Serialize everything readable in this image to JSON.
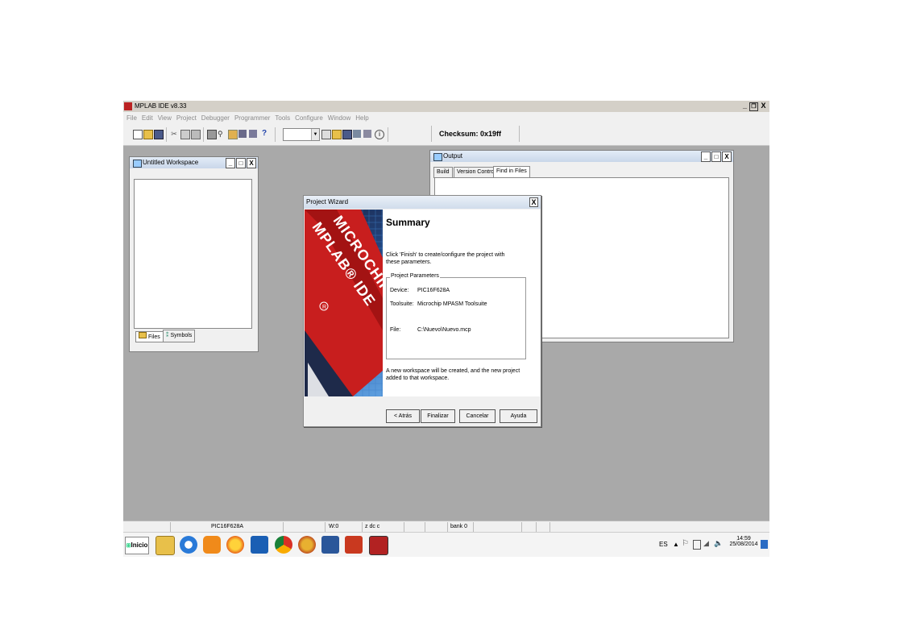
{
  "app": {
    "title": "MPLAB IDE v8.33"
  },
  "window_buttons": {
    "minimize": "_",
    "maximize": "̅□",
    "close": "X"
  },
  "menu": [
    "File",
    "Edit",
    "View",
    "Project",
    "Debugger",
    "Programmer",
    "Tools",
    "Configure",
    "Window",
    "Help"
  ],
  "toolbar": {
    "checksum": "Checksum:  0x19ff"
  },
  "workspace": {
    "title": "Untitled Workspace",
    "tabs": [
      "Files",
      "Symbols"
    ]
  },
  "output": {
    "title": "Output",
    "tabs": [
      "Build",
      "Version Control",
      "Find in Files"
    ]
  },
  "wizard": {
    "title": "Project Wizard",
    "close": "X",
    "heading": "Summary",
    "intro": "Click 'Finish' to create/configure the project with these parameters.",
    "group_label": "Project Parameters",
    "params": [
      {
        "label": "Device:",
        "value": "PIC16F628A"
      },
      {
        "label": "Toolsuite:",
        "value": "Microchip MPASM Toolsuite"
      },
      {
        "label": "File:",
        "value": "C:\\Nuevo\\Nuevo.mcp"
      }
    ],
    "footer": "A new workspace will be created, and the new project added to that workspace.",
    "image_text": [
      "MICROCHIP",
      "MPLAB® IDE"
    ],
    "buttons": {
      "back": "< Atrás",
      "finish": "Finalizar",
      "cancel": "Cancelar",
      "help": "Ayuda"
    }
  },
  "statusbar": {
    "device": "PIC16F628A",
    "w": "W:0",
    "flags": "z dc c",
    "bank": "bank 0"
  },
  "taskbar": {
    "start": "Inicio",
    "lang": "ES",
    "time": "14:59",
    "date": "25/08/2014",
    "apps": [
      "explorer-icon",
      "internet-explorer-icon",
      "media-player-icon",
      "firefox-icon",
      "outlook-icon",
      "chrome-icon",
      "paint-icon",
      "word-icon",
      "powerpoint-icon",
      "mplab-icon"
    ]
  },
  "colors": {
    "workspace_bg": "#a9a9a9",
    "accent": "#b22222"
  }
}
